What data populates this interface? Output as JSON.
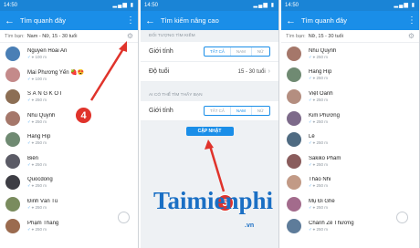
{
  "status_bar": {
    "time": "14:50"
  },
  "nearby": {
    "title": "Tìm quanh đây",
    "filter_label": "Tìm bạn:",
    "filter_value": "Nam - Nữ, 15 - 30 tuổi",
    "people": [
      {
        "name": "Nguyễn Hoài An",
        "distance": "100 m",
        "avatar_color": "#4a7fb5"
      },
      {
        "name": "Mai Phương Yến 🍓😍",
        "distance": "100 m",
        "avatar_color": "#c48a8a"
      },
      {
        "name": "S Á N G K Ô I",
        "distance": "250 m",
        "avatar_color": "#8c6e54"
      },
      {
        "name": "Nhu Quynh",
        "distance": "250 m",
        "avatar_color": "#a5776a"
      },
      {
        "name": "Hằng Híp",
        "distance": "250 m",
        "avatar_color": "#6f8a72"
      },
      {
        "name": "Biên",
        "distance": "250 m",
        "avatar_color": "#5b5b66"
      },
      {
        "name": "Quocdong",
        "distance": "250 m",
        "avatar_color": "#3d3d44"
      },
      {
        "name": "Đinh Văn Tú",
        "distance": "250 m",
        "avatar_color": "#7a8c5e"
      },
      {
        "name": "Phạm Thắng",
        "distance": "250 m",
        "avatar_color": "#9b6b4f"
      }
    ]
  },
  "advanced": {
    "title": "Tìm kiếm nâng cao",
    "section_target": "ĐỐI TƯỢNG TÌM KIẾM",
    "gender_label": "Giới tính",
    "gender_options": [
      "TẤT CẢ",
      "NAM",
      "NỮ"
    ],
    "age_label": "Độ tuổi",
    "age_value": "15 - 30 tuổi",
    "section_visible": "AI CÓ THỂ TÌM THẤY BẠN",
    "visible_gender_label": "Giới tính",
    "update_label": "CẬP NHẬT"
  },
  "filtered": {
    "title": "Tìm quanh đây",
    "filter_label": "Tìm bạn:",
    "filter_value": "Nữ, 15 - 30 tuổi",
    "people": [
      {
        "name": "Nhu Quynh",
        "distance": "250 m",
        "avatar_color": "#a5776a"
      },
      {
        "name": "Hằng Híp",
        "distance": "250 m",
        "avatar_color": "#6f8a72"
      },
      {
        "name": "Việt Oanh",
        "distance": "250 m",
        "avatar_color": "#b48e80"
      },
      {
        "name": "Kim Phương",
        "distance": "250 m",
        "avatar_color": "#7d6a8a"
      },
      {
        "name": "Lê",
        "distance": "250 m",
        "avatar_color": "#4f6b82"
      },
      {
        "name": "Sakiko Pham",
        "distance": "250 m",
        "avatar_color": "#8a5c5c"
      },
      {
        "name": "Thảo Nhi",
        "distance": "250 m",
        "avatar_color": "#c29a86"
      },
      {
        "name": "Mụ Đi Ghé",
        "distance": "250 m",
        "avatar_color": "#a36b8c"
      },
      {
        "name": "Chánh Zê Thương",
        "distance": "250 m",
        "avatar_color": "#5e7c9a"
      }
    ]
  },
  "annotations": {
    "step_a": "4",
    "step_b": "5"
  },
  "watermark": {
    "text": "Taimienphi",
    "suffix": ".vn"
  },
  "colors": {
    "accent": "#1a8ee8",
    "status": "#1a84d6",
    "badge": "#e0332b"
  }
}
